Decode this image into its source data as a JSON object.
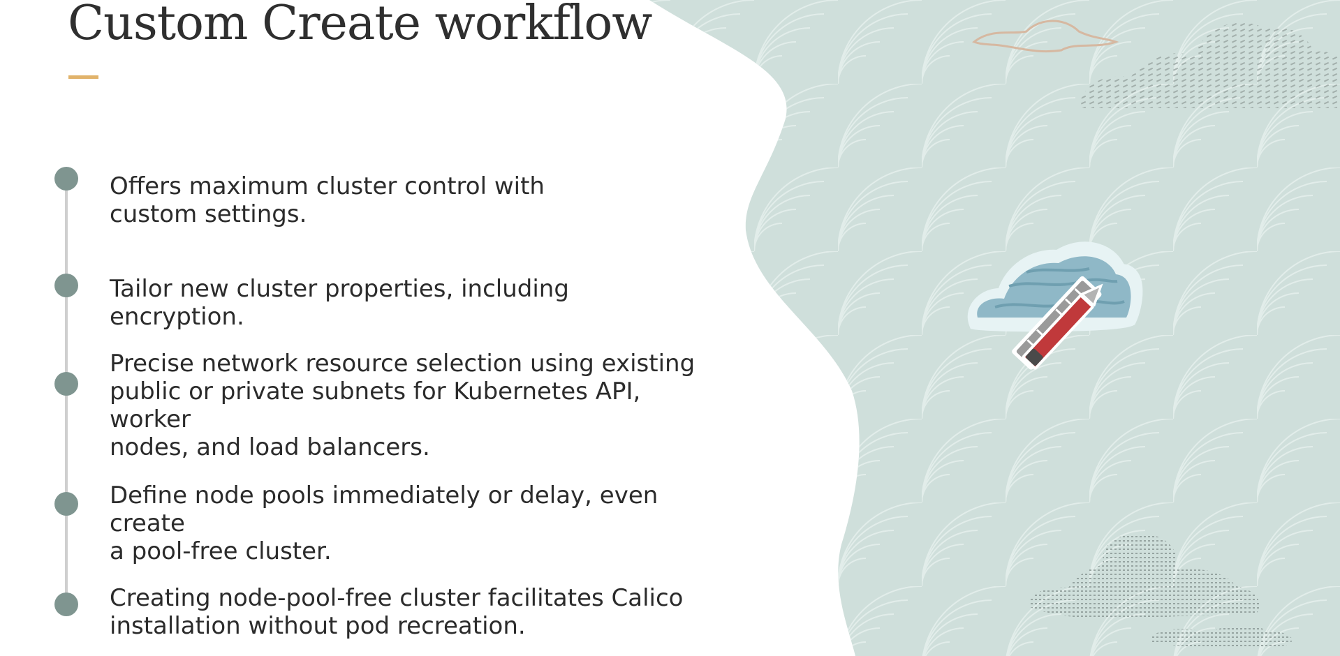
{
  "slide": {
    "title": "Custom Create workflow",
    "points": [
      {
        "text": "Offers maximum cluster control with\ncustom settings."
      },
      {
        "text": "Tailor new cluster properties, including encryption."
      },
      {
        "text": "Precise network resource selection using existing\npublic or private subnets for Kubernetes API, worker\nnodes, and load balancers."
      },
      {
        "text": "Define node pools immediately or delay, even create\na pool-free cluster."
      },
      {
        "text": "Creating node-pool-free cluster facilitates Calico\ninstallation without pod recreation."
      }
    ]
  },
  "colors": {
    "title": "#2f2f2f",
    "accent": "#e1b36b",
    "timeline_dot": "#7f9590",
    "timeline_line": "#cfcfcf",
    "panel_bg": "#cfdfdb",
    "pencil_red": "#c0393b"
  },
  "illustration": {
    "icon": "cloud-with-pencil-and-ruler-icon"
  }
}
